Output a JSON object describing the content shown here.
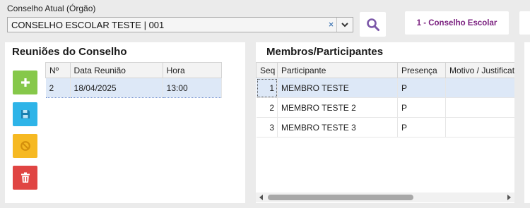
{
  "header": {
    "field_label": "Conselho Atual (Órgão)",
    "select_value": "CONSELHO ESCOLAR TESTE | 001",
    "clear_glyph": "×",
    "tab_label": "1 - Conselho Escolar"
  },
  "meetings": {
    "title": "Reuniões do Conselho",
    "columns": [
      "Nº",
      "Data Reunião",
      "Hora"
    ],
    "rows": [
      {
        "num": "2",
        "date": "18/04/2025",
        "time": "13:00"
      }
    ]
  },
  "members": {
    "title": "Membros/Participantes",
    "columns": [
      "Seq",
      "Participante",
      "Presença",
      "Motivo / Justificativa"
    ],
    "rows": [
      {
        "seq": "1",
        "name": "MEMBRO TESTE",
        "presence": "P",
        "reason": ""
      },
      {
        "seq": "2",
        "name": "MEMBRO TESTE 2",
        "presence": "P",
        "reason": ""
      },
      {
        "seq": "3",
        "name": "MEMBRO TESTE 3",
        "presence": "P",
        "reason": ""
      }
    ],
    "scroll_position": 0.62
  },
  "icons": {
    "search": "search-icon",
    "add": "plus-icon",
    "save": "save-icon",
    "cancel": "cancel-icon",
    "delete": "trash-icon"
  },
  "colors": {
    "add": "#86c84a",
    "save": "#2eb4e8",
    "cancel": "#f6b922",
    "delete": "#e04543",
    "tab_text": "#7a1f7f",
    "selected_row": "#dde8f7"
  }
}
